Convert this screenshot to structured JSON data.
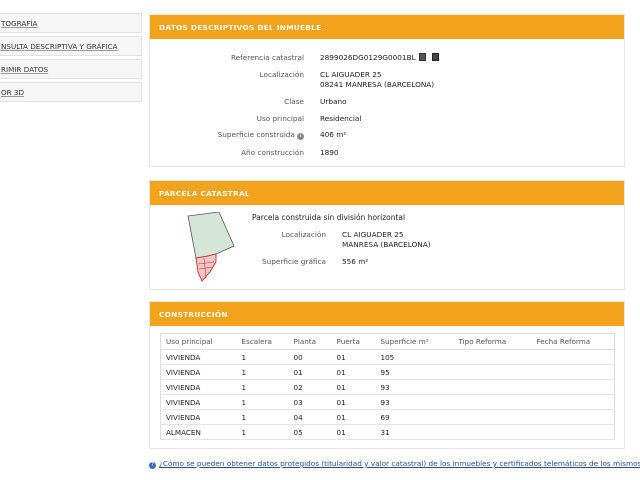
{
  "sidebar": {
    "items": [
      {
        "label": "TOGRAFÍA"
      },
      {
        "label": "NSULTA DESCRIPTIVA Y GRÁFICA"
      },
      {
        "label": "RIMIR DATOS"
      },
      {
        "label": "OR 3D"
      }
    ]
  },
  "descriptivos": {
    "title": "DATOS DESCRIPTIVOS DEL INMUEBLE",
    "ref_label": "Referencia catastral",
    "ref_value": "2899026DG0129G0001BL",
    "loc_label": "Localización",
    "loc_line1": "CL AIGUADER 25",
    "loc_line2": "08241 MANRESA (BARCELONA)",
    "clase_label": "Clase",
    "clase_value": "Urbano",
    "uso_label": "Uso principal",
    "uso_value": "Residencial",
    "sup_label": "Superficie construida",
    "sup_value": "406 m²",
    "anio_label": "Año construcción",
    "anio_value": "1890"
  },
  "parcela": {
    "title": "PARCELA CATASTRAL",
    "subtitle": "Parcela construida sin división horizontal",
    "loc_label": "Localización",
    "loc_line1": "CL AIGUADER 25",
    "loc_line2": "MANRESA (BARCELONA)",
    "sup_label": "Superficie gráfica",
    "sup_value": "556 m²"
  },
  "construccion": {
    "title": "CONSTRUCCIÓN",
    "headers": [
      "Uso principal",
      "Escalera",
      "Planta",
      "Puerta",
      "Superficie m²",
      "Tipo Reforma",
      "Fecha Reforma"
    ],
    "rows": [
      [
        "VIVIENDA",
        "1",
        "00",
        "01",
        "105",
        "",
        ""
      ],
      [
        "VIVIENDA",
        "1",
        "01",
        "01",
        "95",
        "",
        ""
      ],
      [
        "VIVIENDA",
        "1",
        "02",
        "01",
        "93",
        "",
        ""
      ],
      [
        "VIVIENDA",
        "1",
        "03",
        "01",
        "93",
        "",
        ""
      ],
      [
        "VIVIENDA",
        "1",
        "04",
        "01",
        "69",
        "",
        ""
      ],
      [
        "ALMACEN",
        "1",
        "05",
        "01",
        "31",
        "",
        ""
      ]
    ]
  },
  "footer": {
    "link": "¿Cómo se pueden obtener datos protegidos (titularidad y valor catastral) de los inmuebles y certificados telemáticos de los mismos?"
  },
  "icons": {
    "copy": "copy-icon",
    "document": "document-icon",
    "info": "info-icon",
    "help": "help-icon"
  },
  "colors": {
    "header": "#f4a41c",
    "parcel_fill": "#d5e6d8",
    "building_fill": "#f2c6c6",
    "link": "#2b4c8a"
  }
}
